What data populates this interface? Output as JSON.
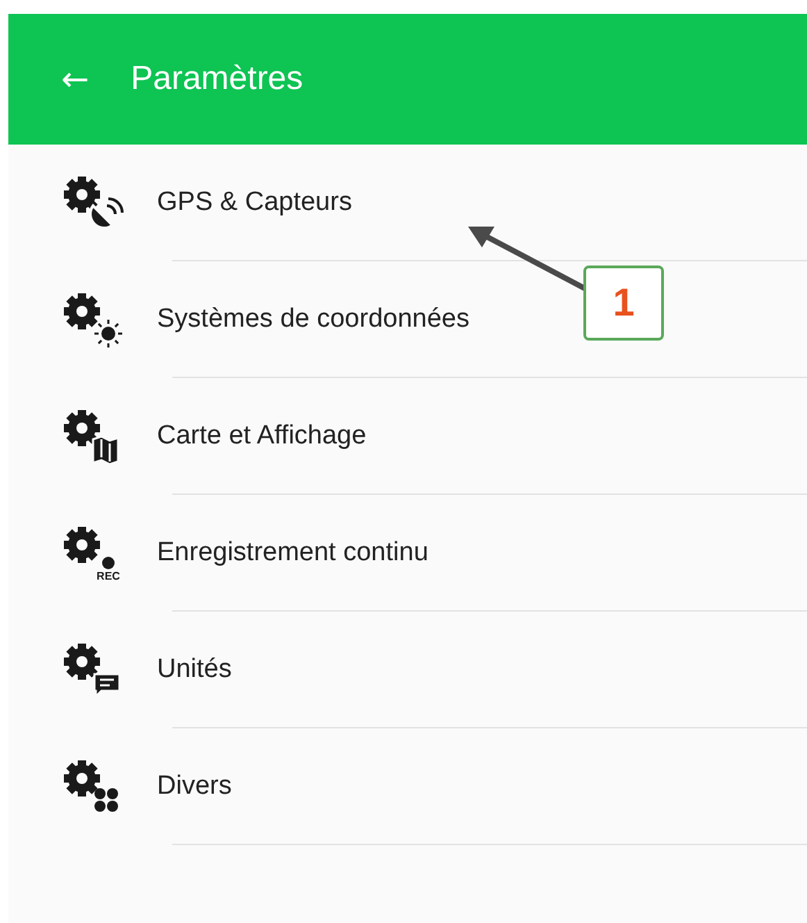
{
  "app_bar": {
    "back_icon": "←",
    "title": "Paramètres"
  },
  "items": [
    {
      "label": "GPS & Capteurs",
      "kind": "satellite"
    },
    {
      "label": "Systèmes de coordonnées",
      "kind": "sun"
    },
    {
      "label": "Carte et Affichage",
      "kind": "map"
    },
    {
      "label": "Enregistrement continu",
      "kind": "rec",
      "badge_text": "REC"
    },
    {
      "label": "Unités",
      "kind": "chat"
    },
    {
      "label": "Divers",
      "kind": "dots"
    }
  ],
  "callout": {
    "label": "1"
  }
}
